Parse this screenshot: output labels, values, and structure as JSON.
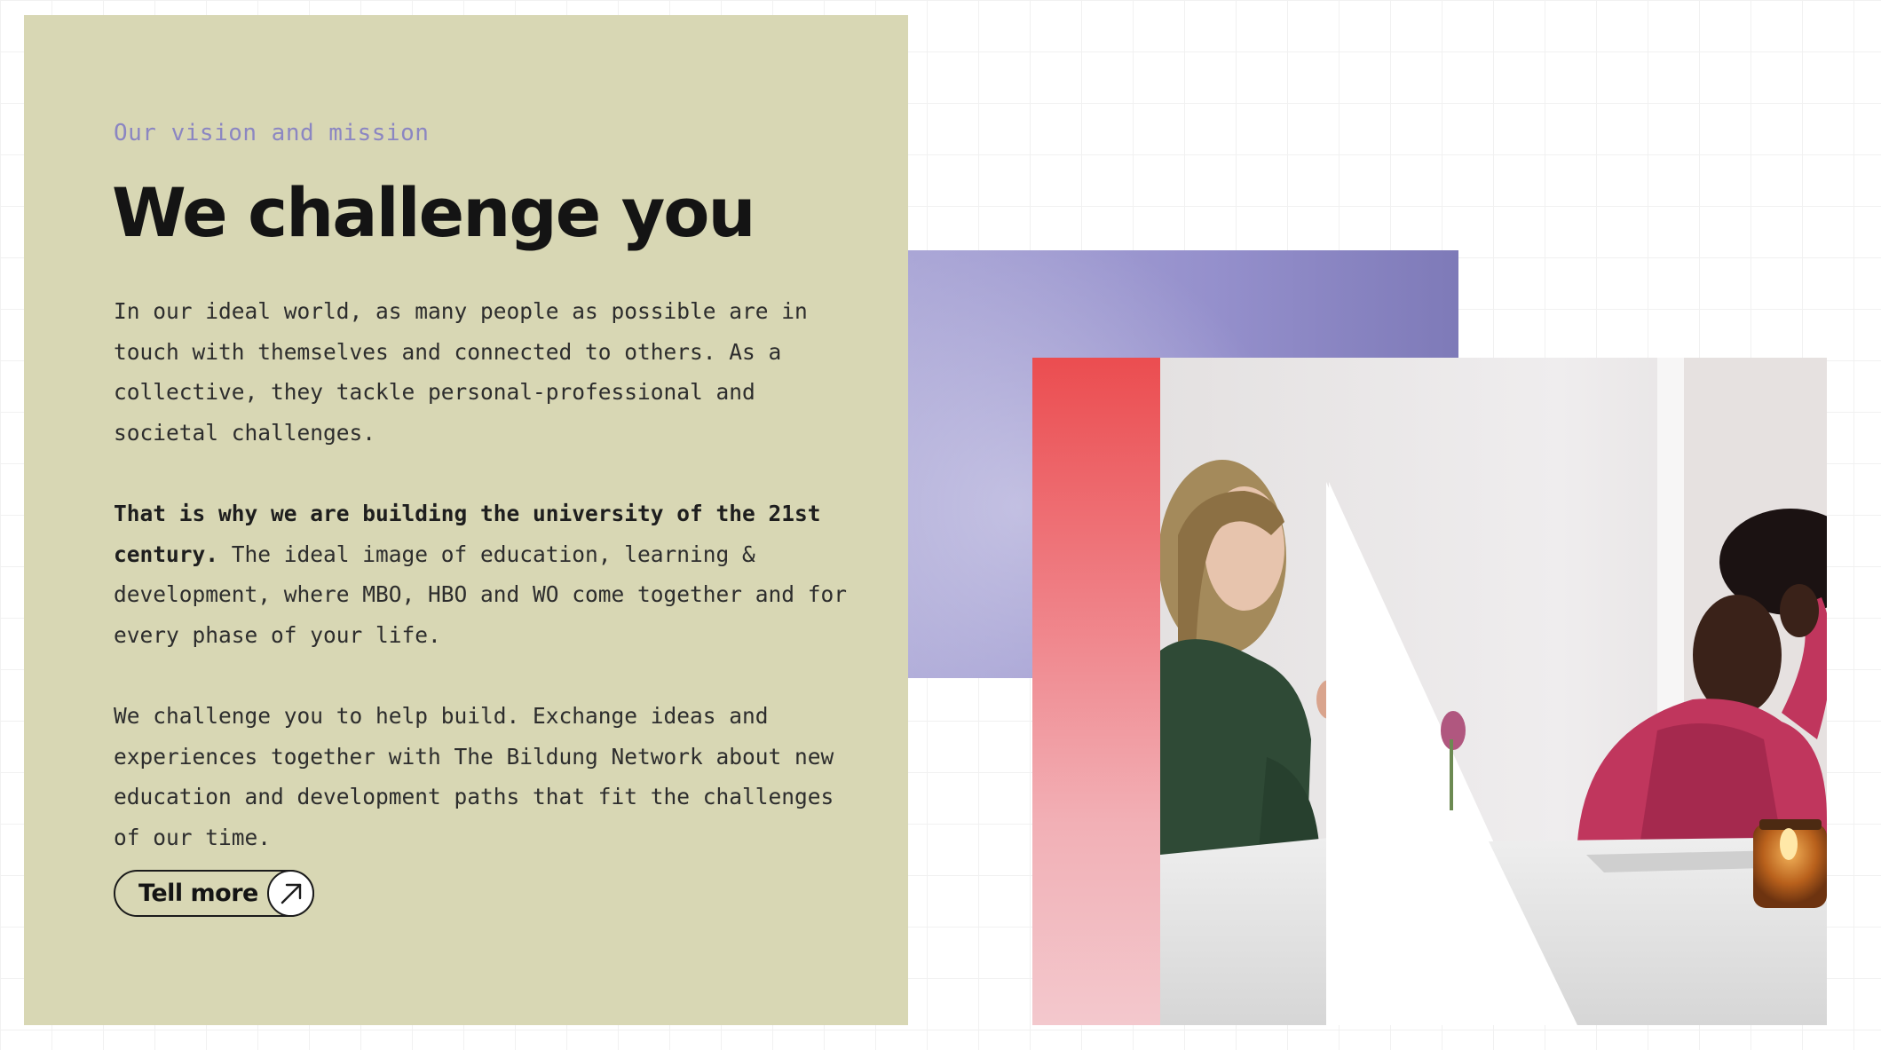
{
  "section": {
    "eyebrow": "Our vision and mission",
    "title": "We challenge you",
    "paragraph_1": "In our ideal world, as many people as possible are in touch with themselves and connected to others. As a collective, they tackle personal-professional and societal challenges.",
    "paragraph_2_bold": "That is why we are building the university of the 21st century.",
    "paragraph_2_rest": " The ideal image of education, learning & development, where MBO, HBO and WO come together and for every phase of your life.",
    "paragraph_3": "We challenge you to help build. Exchange ideas and experiences together with The Bildung Network about new education and development paths that fit the challenges of our time.",
    "cta_label": "Tell more",
    "cta_icon": "arrow-up-right-icon"
  },
  "colors": {
    "card_background": "#d8d7b4",
    "eyebrow": "#8b86c2",
    "accent_purple": "#8f8ac8",
    "accent_red": "#eb4d50"
  },
  "visual": {
    "photo_description_icon": "photo-two-women-talking"
  }
}
